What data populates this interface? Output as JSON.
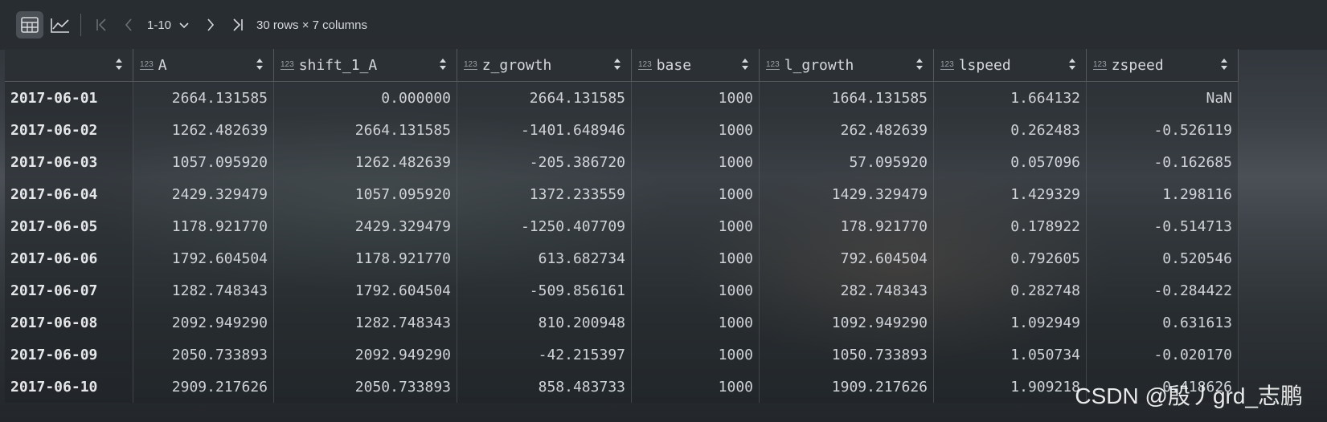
{
  "toolbar": {
    "page_range": "1-10",
    "summary": "30 rows × 7 columns"
  },
  "table": {
    "type_badge": "123",
    "columns": [
      "A",
      "shift_1_A",
      "z_growth",
      "base",
      "l_growth",
      "lspeed",
      "zspeed"
    ],
    "rows": [
      [
        "2017-06-01",
        "2664.131585",
        "0.000000",
        "2664.131585",
        "1000",
        "1664.131585",
        "1.664132",
        "NaN"
      ],
      [
        "2017-06-02",
        "1262.482639",
        "2664.131585",
        "-1401.648946",
        "1000",
        "262.482639",
        "0.262483",
        "-0.526119"
      ],
      [
        "2017-06-03",
        "1057.095920",
        "1262.482639",
        "-205.386720",
        "1000",
        "57.095920",
        "0.057096",
        "-0.162685"
      ],
      [
        "2017-06-04",
        "2429.329479",
        "1057.095920",
        "1372.233559",
        "1000",
        "1429.329479",
        "1.429329",
        "1.298116"
      ],
      [
        "2017-06-05",
        "1178.921770",
        "2429.329479",
        "-1250.407709",
        "1000",
        "178.921770",
        "0.178922",
        "-0.514713"
      ],
      [
        "2017-06-06",
        "1792.604504",
        "1178.921770",
        "613.682734",
        "1000",
        "792.604504",
        "0.792605",
        "0.520546"
      ],
      [
        "2017-06-07",
        "1282.748343",
        "1792.604504",
        "-509.856161",
        "1000",
        "282.748343",
        "0.282748",
        "-0.284422"
      ],
      [
        "2017-06-08",
        "2092.949290",
        "1282.748343",
        "810.200948",
        "1000",
        "1092.949290",
        "1.092949",
        "0.631613"
      ],
      [
        "2017-06-09",
        "2050.733893",
        "2092.949290",
        "-42.215397",
        "1000",
        "1050.733893",
        "1.050734",
        "-0.020170"
      ],
      [
        "2017-06-10",
        "2909.217626",
        "2050.733893",
        "858.483733",
        "1000",
        "1909.217626",
        "1.909218",
        "0.418626"
      ]
    ]
  },
  "watermark": "CSDN @殷丿grd_志鹏"
}
